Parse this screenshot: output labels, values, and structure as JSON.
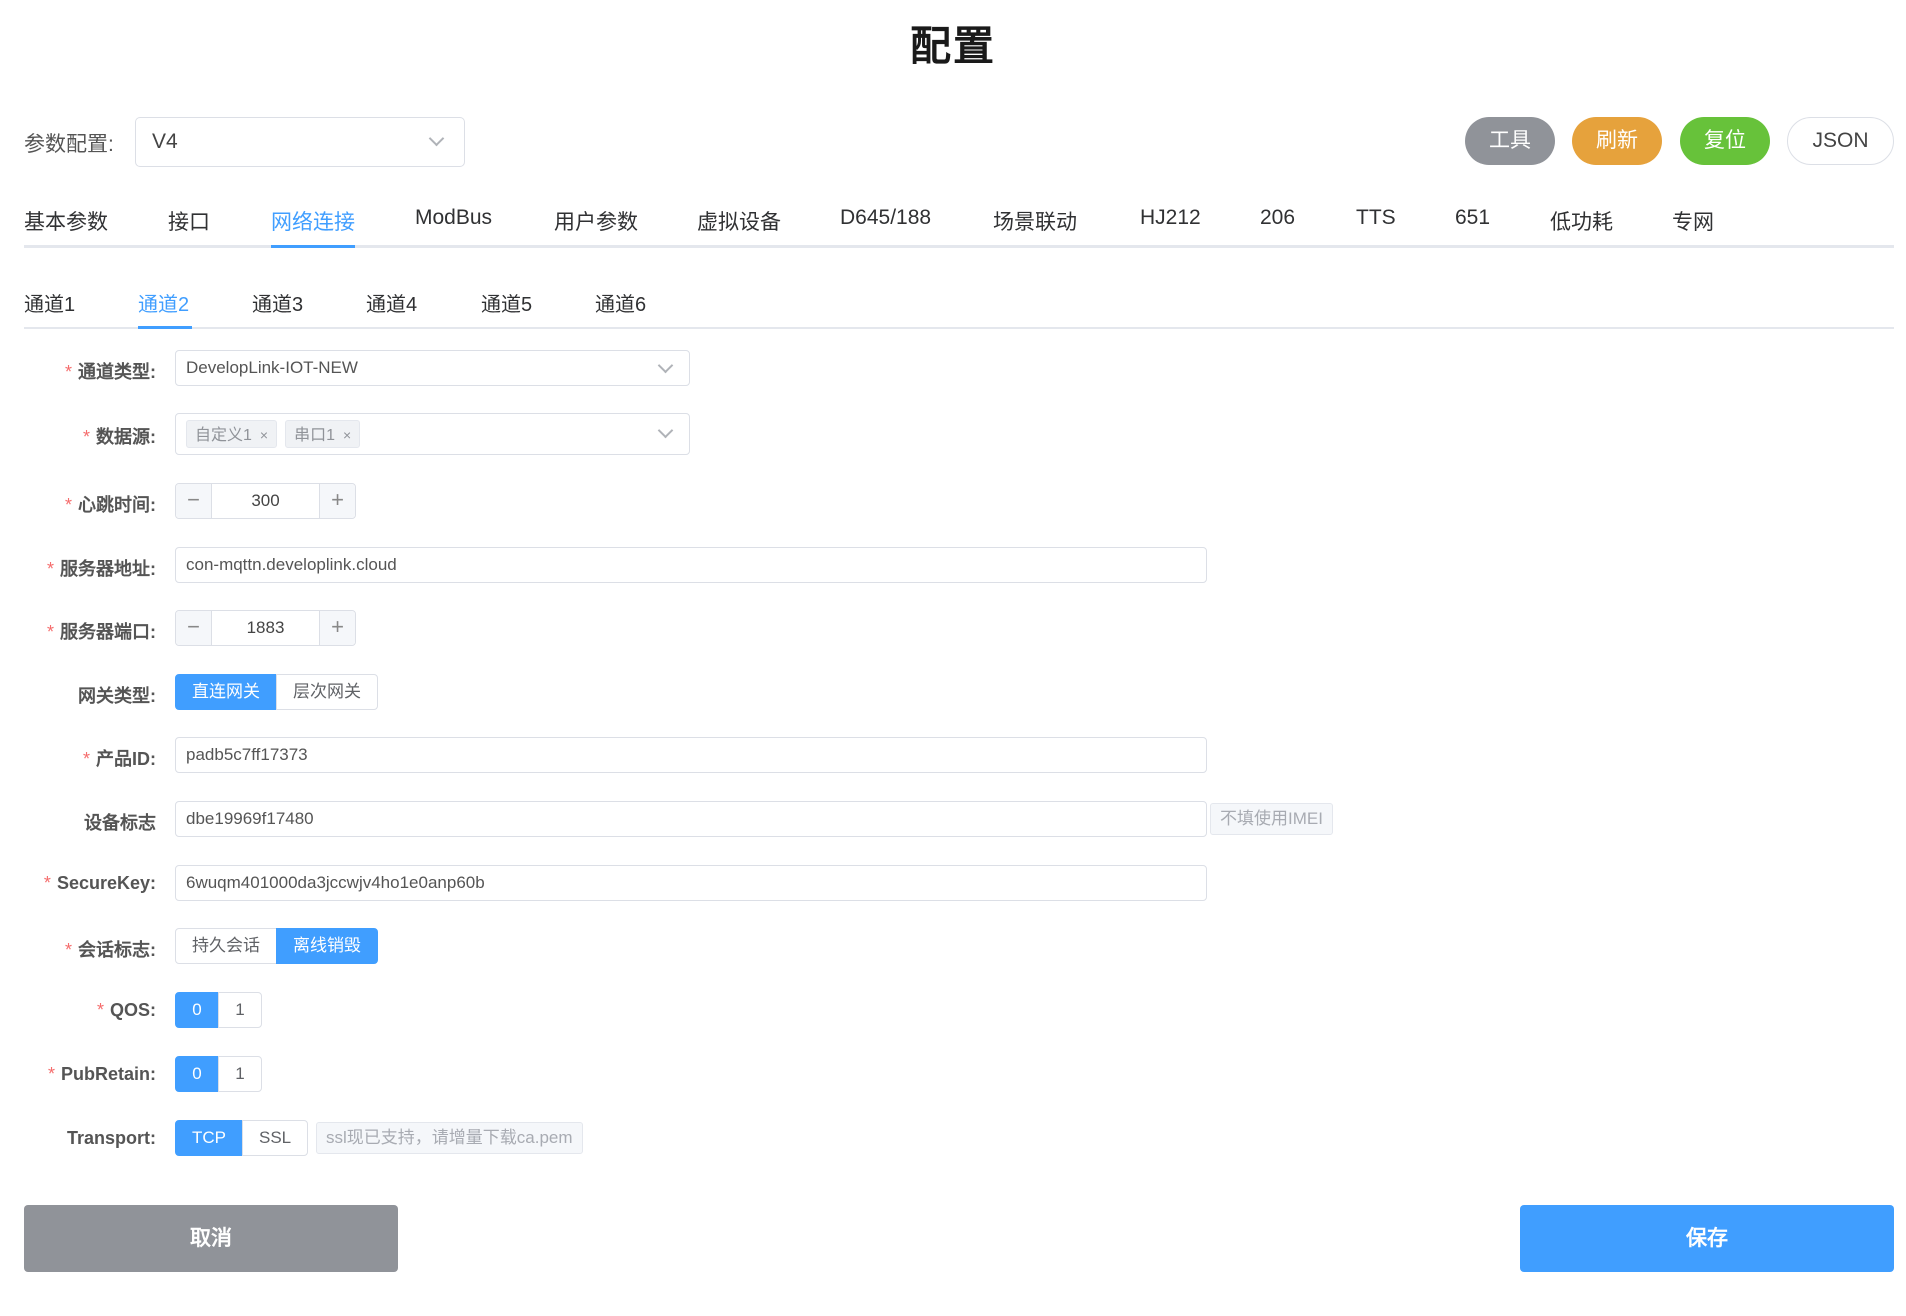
{
  "page": {
    "title": "配置"
  },
  "top": {
    "param_label": "参数配置:",
    "version_value": "V4",
    "buttons": {
      "tools": "工具",
      "refresh": "刷新",
      "reset": "复位",
      "json": "JSON"
    }
  },
  "tabs": [
    {
      "label": "基本参数"
    },
    {
      "label": "接口"
    },
    {
      "label": "网络连接",
      "active": true
    },
    {
      "label": "ModBus"
    },
    {
      "label": "用户参数"
    },
    {
      "label": "虚拟设备"
    },
    {
      "label": "D645/188"
    },
    {
      "label": "场景联动"
    },
    {
      "label": "HJ212"
    },
    {
      "label": "206"
    },
    {
      "label": "TTS"
    },
    {
      "label": "651"
    },
    {
      "label": "低功耗"
    },
    {
      "label": "专网"
    }
  ],
  "subtabs": [
    {
      "label": "通道1"
    },
    {
      "label": "通道2",
      "active": true
    },
    {
      "label": "通道3"
    },
    {
      "label": "通道4"
    },
    {
      "label": "通道5"
    },
    {
      "label": "通道6"
    }
  ],
  "form": {
    "channel_type": {
      "label": "通道类型:",
      "value": "DevelopLink-IOT-NEW",
      "required": true
    },
    "data_source": {
      "label": "数据源:",
      "required": true,
      "tags": [
        "自定义1",
        "串口1"
      ],
      "tag_remove": "×"
    },
    "heartbeat": {
      "label": "心跳时间:",
      "value": "300",
      "required": true,
      "minus": "−",
      "plus": "+"
    },
    "server_address": {
      "label": "服务器地址:",
      "value": "con-mqttn.developlink.cloud",
      "required": true
    },
    "server_port": {
      "label": "服务器端口:",
      "value": "1883",
      "required": true,
      "minus": "−",
      "plus": "+"
    },
    "gateway_type": {
      "label": "网关类型:",
      "options": [
        "直连网关",
        "层次网关"
      ],
      "selected": "直连网关"
    },
    "product_id": {
      "label": "产品ID:",
      "value": "padb5c7ff17373",
      "required": true
    },
    "device_id": {
      "label": "设备标志",
      "value": "dbe19969f17480",
      "hint": "不填使用IMEI"
    },
    "secure_key": {
      "label": "SecureKey:",
      "value": "6wuqm401000da3jccwjv4ho1e0anp60b",
      "required": true
    },
    "session_flag": {
      "label": "会话标志:",
      "options": [
        "持久会话",
        "离线销毁"
      ],
      "selected": "离线销毁",
      "required": true
    },
    "qos": {
      "label": "QOS:",
      "options": [
        "0",
        "1"
      ],
      "selected": "0",
      "required": true
    },
    "pub_retain": {
      "label": "PubRetain:",
      "options": [
        "0",
        "1"
      ],
      "selected": "0",
      "required": true
    },
    "transport": {
      "label": "Transport:",
      "options": [
        "TCP",
        "SSL"
      ],
      "selected": "TCP",
      "hint": "ssl现已支持，请增量下载ca.pem"
    }
  },
  "actions": {
    "cancel": "取消",
    "save": "保存"
  },
  "colors": {
    "primary": "#409eff",
    "warning": "#e6a23c",
    "success": "#67c23a",
    "info": "#909399",
    "required": "#f56c6c"
  },
  "icons": {
    "select_arrow": "chevron-down-icon",
    "tag_close": "close-icon"
  }
}
